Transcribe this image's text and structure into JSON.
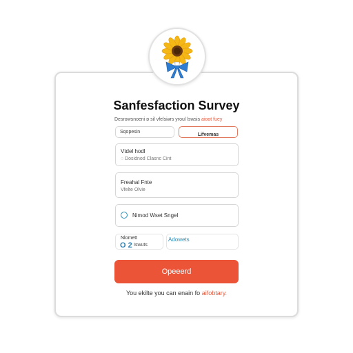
{
  "form": {
    "title": "Sanfesfaction Survey",
    "subtitle_prefix": "Desrowsnoeni ɒ sil vfelsiǝrs yroul lswsis ",
    "subtitle_accent": "aioot fuey",
    "segment_left": "Sqopesin",
    "segment_right": "Lifvemas",
    "field1_label": "Vtdel hodl",
    "field1_value": "◌ Dosidnod Clasnc Cint",
    "field2_label": "Freahal Fnte",
    "field2_value": "Vfelte Olvie",
    "field3_label": "Nimod Wset Sngel",
    "field4_label": "Nlomett",
    "field4_number": "O 2",
    "field4_unit": "Iswuts",
    "field5_link": "Adowets",
    "submit_label": "Opeeerd",
    "footer_prefix": "You ekilte you can enain fo ",
    "footer_accent": "aifobtary."
  },
  "colors": {
    "accent": "#ec5437",
    "link": "#2a8fb8"
  },
  "icons": {
    "badge": "sunflower-bow-icon",
    "radio": "radio-circle-icon"
  }
}
